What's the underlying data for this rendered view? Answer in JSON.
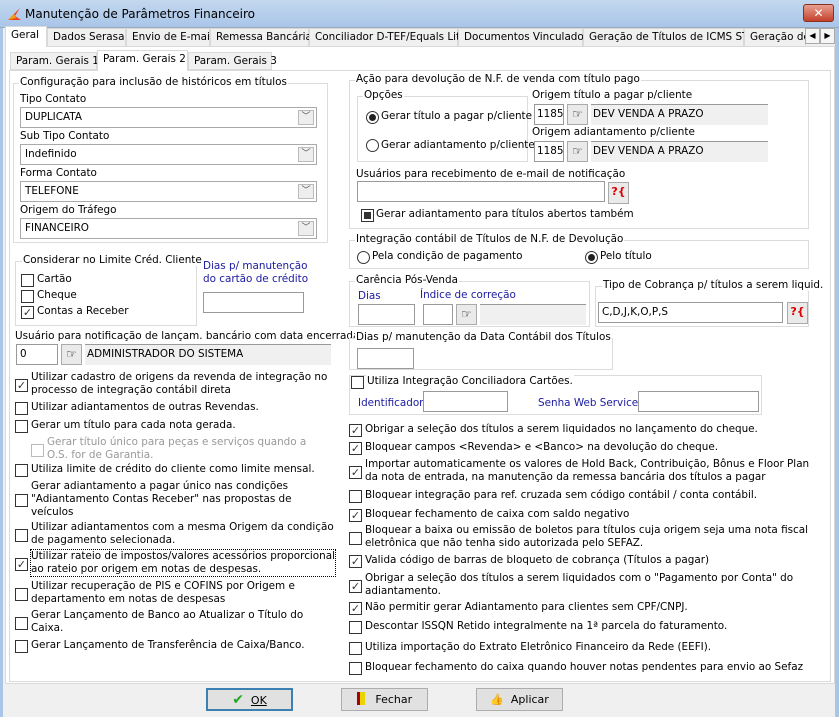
{
  "window": {
    "title": "Manutenção de Parâmetros Financeiro",
    "close_icon": "close-icon"
  },
  "tabs": [
    "Geral",
    "Dados Serasa",
    "Envio de E-mail",
    "Remessa Bancária",
    "Conciliador D-TEF/Equals Lite",
    "Documentos Vinculados",
    "Geração de Títulos de ICMS ST",
    "Geração de"
  ],
  "subtabs": [
    "Param. Gerais 1",
    "Param. Gerais 2",
    "Param. Gerais 3"
  ],
  "config": {
    "legend": "Configuração para inclusão de históricos em títulos",
    "tipo_label": "Tipo Contato",
    "tipo_value": "DUPLICATA",
    "subtipo_label": "Sub Tipo Contato",
    "subtipo_value": "Indefinido",
    "forma_label": "Forma Contato",
    "forma_value": "TELEFONE",
    "origem_label": "Origem do Tráfego",
    "origem_value": "FINANCEIRO"
  },
  "limite": {
    "legend": "Considerar no  Limite Créd. Cliente",
    "items": [
      {
        "label": "Cartão",
        "checked": false
      },
      {
        "label": "Cheque",
        "checked": false
      },
      {
        "label": "Contas a Receber",
        "checked": true
      }
    ]
  },
  "dias_cartao": {
    "label1": "Dias p/ manutenção",
    "label2": "do cartão de crédito",
    "value": ""
  },
  "usuario_notif": {
    "label": "Usuário para notificação de lançam. bancário com data encerrada",
    "code": "0",
    "name": "ADMINISTRADOR DO SISTEMA"
  },
  "left_options": [
    {
      "lines": [
        "Utilizar cadastro de origens da revenda de integração no",
        "processo de integração contábil direta"
      ],
      "checked": true
    },
    {
      "lines": [
        "Utilizar adiantamentos de outras Revendas."
      ],
      "checked": false
    },
    {
      "lines": [
        "Gerar um título para cada nota gerada."
      ],
      "checked": false
    },
    {
      "lines": [
        "Gerar título único para peças e serviços quando a",
        "O.S. for de Garantia."
      ],
      "checked": false,
      "disabled": true
    },
    {
      "lines": [
        "Utiliza limite de crédito do cliente como limite mensal."
      ],
      "checked": false
    },
    {
      "lines": [
        "Gerar adiantamento a pagar único nas condições",
        "\"Adiantamento Contas Receber\" nas propostas de",
        "veículos"
      ],
      "checked": false
    },
    {
      "lines": [
        "Utilizar adiantamentos com a mesma Origem da condição",
        "de pagamento selecionada."
      ],
      "checked": false
    },
    {
      "lines": [
        "Utilizar rateio de impostos/valores acessórios proporcional",
        "ao rateio por origem em notas de despesas."
      ],
      "checked": true,
      "focused": true
    },
    {
      "lines": [
        "Utilizar recuperação de PIS e COFINS por Origem e",
        "departamento em notas de despesas"
      ],
      "checked": false
    },
    {
      "lines": [
        "Gerar Lançamento de Banco ao Atualizar o Título do",
        "Caixa."
      ],
      "checked": false
    },
    {
      "lines": [
        "Gerar Lançamento de Transferência de Caixa/Banco."
      ],
      "checked": false
    }
  ],
  "acao": {
    "legend": "Ação para devolução de N.F. de venda com título pago",
    "opcoes_legend": "Opções",
    "radio1": "Gerar título a pagar p/cliente",
    "radio2": "Gerar adiantamento p/cliente",
    "selected": "radio1",
    "origem_titulo_label": "Origem título a pagar p/cliente",
    "origem_titulo_code": "1185",
    "origem_titulo_desc": "DEV VENDA A PRAZO",
    "origem_adiant_label": "Origem adiantamento p/cliente",
    "origem_adiant_code": "1185",
    "origem_adiant_desc": "DEV VENDA A PRAZO",
    "usuarios_label": "Usuários para recebimento de e-mail de notificação",
    "usuarios_value": "",
    "help_btn": "?{",
    "gerar_abertos_label": "Gerar adiantamento para títulos abertos também",
    "gerar_abertos_state": "indeterminate"
  },
  "integracao": {
    "legend": "Integração contábil de Títulos de N.F. de Devolução",
    "radio1": "Pela condição de pagamento",
    "radio2": "Pelo título",
    "selected": "radio2"
  },
  "carencia": {
    "legend": "Carência Pós-Venda",
    "dias_label": "Dias",
    "dias_value": "",
    "indice_label": "Índice de correção",
    "indice_code": "",
    "indice_desc": ""
  },
  "cobranca": {
    "legend": "Tipo de Cobrança p/ títulos a serem liquid.",
    "value": "C,D,J,K,O,P,S",
    "help_btn": "?{"
  },
  "dias_contabil": {
    "legend": "Dias p/ manutenção da Data Contábil dos Títulos",
    "value": ""
  },
  "conciliadora": {
    "label": "Utiliza Integração Conciliadora Cartões.",
    "checked": false,
    "identificador_label": "Identificador",
    "identificador_value": "",
    "senha_label": "Senha Web Service",
    "senha_value": ""
  },
  "right_options": [
    {
      "lines": [
        "Obrigar a seleção dos títulos a serem liquidados no lançamento do cheque."
      ],
      "checked": true
    },
    {
      "lines": [
        "Bloquear campos <Revenda> e <Banco> na devolução do cheque."
      ],
      "checked": true
    },
    {
      "lines": [
        "Importar automaticamente os valores de Hold Back, Contribuição, Bônus e Floor Plan",
        "da nota de entrada, na manutenção da remessa bancária dos títulos a pagar"
      ],
      "checked": true
    },
    {
      "lines": [
        "Bloquear integração para ref. cruzada sem código contábil / conta contábil."
      ],
      "checked": false
    },
    {
      "lines": [
        "Bloquear fechamento de caixa com saldo negativo"
      ],
      "checked": true
    },
    {
      "lines": [
        "Bloquear a baixa ou emissão de boletos para títulos cuja origem seja uma nota fiscal",
        "eletrônica que não tenha sido autorizada pelo SEFAZ."
      ],
      "checked": false
    },
    {
      "lines": [
        "Valida código de barras de bloqueto de cobrança (Títulos a pagar)"
      ],
      "checked": true
    },
    {
      "lines": [
        "Obrigar a seleção dos títulos a serem liquidados com o \"Pagamento por Conta\" do",
        "adiantamento."
      ],
      "checked": true
    },
    {
      "lines": [
        "Não permitir gerar Adiantamento para clientes sem CPF/CNPJ."
      ],
      "checked": true
    },
    {
      "lines": [
        "Descontar ISSQN Retido integralmente na 1ª parcela do faturamento."
      ],
      "checked": false
    },
    {
      "lines": [
        "Utiliza importação do Extrato Eletrônico Financeiro da Rede (EEFI)."
      ],
      "checked": false
    },
    {
      "lines": [
        "Bloquear fechamento do caixa quando houver notas pendentes para envio ao Sefaz"
      ],
      "checked": false
    }
  ],
  "buttons": {
    "ok": "OK",
    "fechar": "Fechar",
    "aplicar": "Aplicar"
  }
}
